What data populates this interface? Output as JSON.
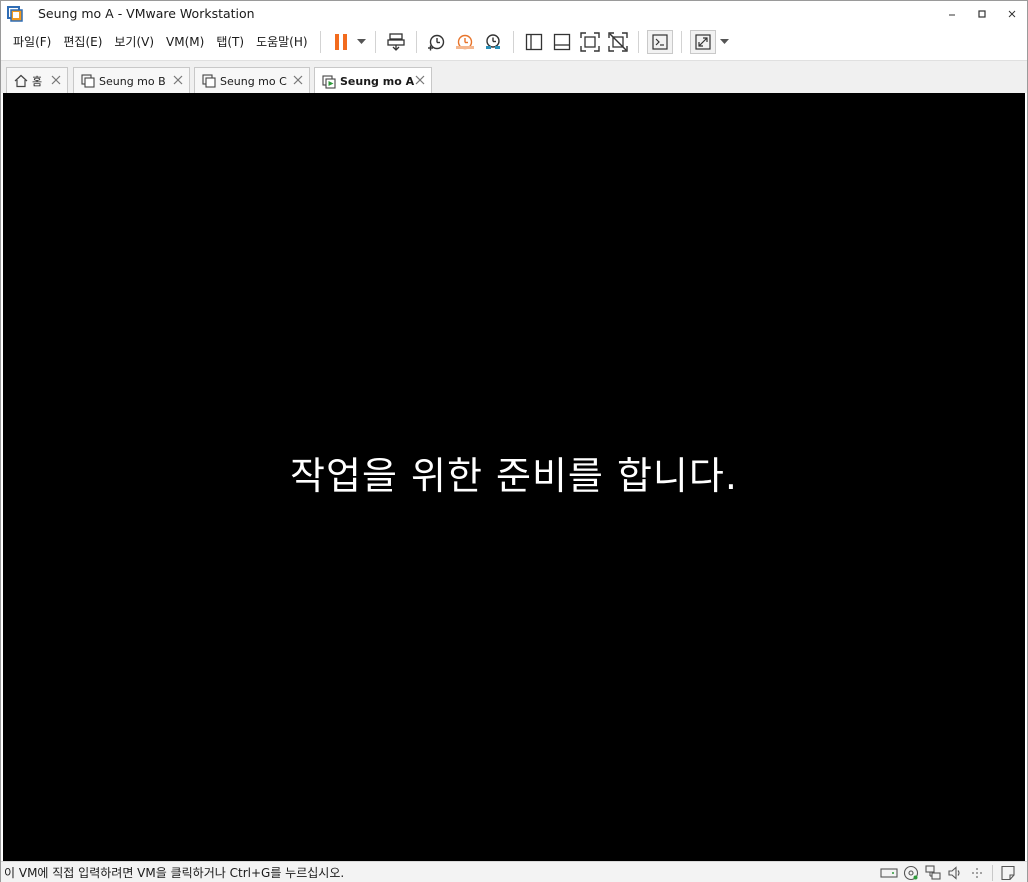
{
  "window": {
    "title": "Seung mo A - VMware Workstation"
  },
  "menu": {
    "items": [
      {
        "label": "파일(F)"
      },
      {
        "label": "편집(E)"
      },
      {
        "label": "보기(V)"
      },
      {
        "label": "VM(M)"
      },
      {
        "label": "탭(T)"
      },
      {
        "label": "도움말(H)"
      }
    ]
  },
  "toolbar": {
    "icons": [
      "pause-icon",
      "send-keys-icon",
      "snapshot-take-icon",
      "snapshot-revert-icon",
      "snapshot-manager-icon",
      "library-icon",
      "thumbnail-bar-icon",
      "fullscreen-icon",
      "unity-icon",
      "console-icon",
      "stretch-icon"
    ]
  },
  "tabs": [
    {
      "label": "홈",
      "icon": "home-icon",
      "active": false
    },
    {
      "label": "Seung mo B",
      "icon": "vm-icon",
      "active": false
    },
    {
      "label": "Seung mo C",
      "icon": "vm-icon",
      "active": false
    },
    {
      "label": "Seung mo A",
      "icon": "vm-running-icon",
      "active": true
    }
  ],
  "vm_screen": {
    "message": "작업을 위한 준비를 합니다."
  },
  "statusbar": {
    "hint": "이 VM에 직접 입력하려면 VM을 클릭하거나 Ctrl+G를 누르십시오."
  },
  "colors": {
    "pause_accent": "#f26b1d",
    "snapshot_accent": "#e8742a",
    "snapshot_teal": "#2a8fb8",
    "vm_background": "#000000",
    "vm_text": "#ffffff"
  }
}
